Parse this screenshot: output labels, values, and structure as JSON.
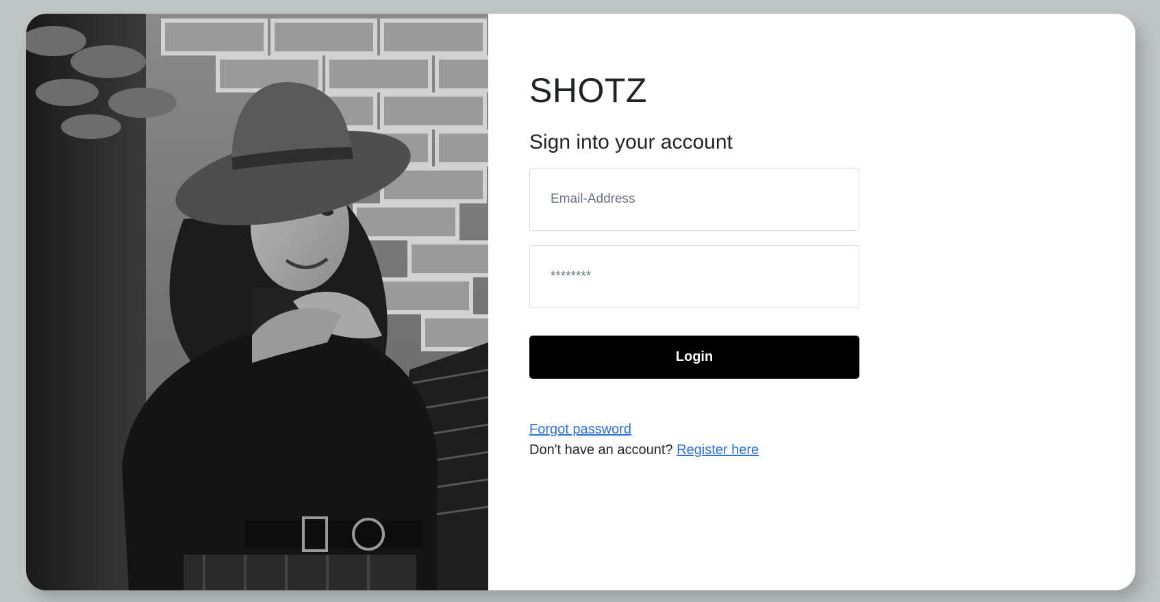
{
  "brand": {
    "name": "SHOTZ"
  },
  "form": {
    "heading": "Sign into your account",
    "email_placeholder": "Email-Address",
    "password_placeholder": "********",
    "login_label": "Login",
    "forgot_label": "Forgot password",
    "register_prompt": "Don't have an account?",
    "register_label": "Register here"
  },
  "photo": {
    "subject": "woman-in-hat-photo"
  },
  "colors": {
    "background": "#bec4c4",
    "button": "#000000",
    "link": "#2b6fe0",
    "text": "#1f2326"
  }
}
